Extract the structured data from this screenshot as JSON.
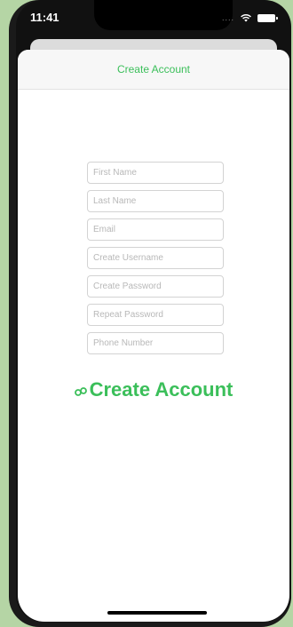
{
  "status_bar": {
    "time": "11:41",
    "signal_text": "....",
    "icons": [
      "wifi-icon",
      "battery-icon"
    ]
  },
  "nav": {
    "title": "Create Account"
  },
  "form": {
    "fields": [
      {
        "placeholder": "First Name",
        "value": ""
      },
      {
        "placeholder": "Last Name",
        "value": ""
      },
      {
        "placeholder": "Email",
        "value": ""
      },
      {
        "placeholder": "Create Username",
        "value": ""
      },
      {
        "placeholder": "Create Password",
        "value": ""
      },
      {
        "placeholder": "Repeat Password",
        "value": ""
      },
      {
        "placeholder": "Phone Number",
        "value": ""
      }
    ]
  },
  "action": {
    "create_label": "Create Account",
    "icon": "key-icon"
  },
  "colors": {
    "accent": "#3bbf5a",
    "background": "#b5d5a5"
  }
}
